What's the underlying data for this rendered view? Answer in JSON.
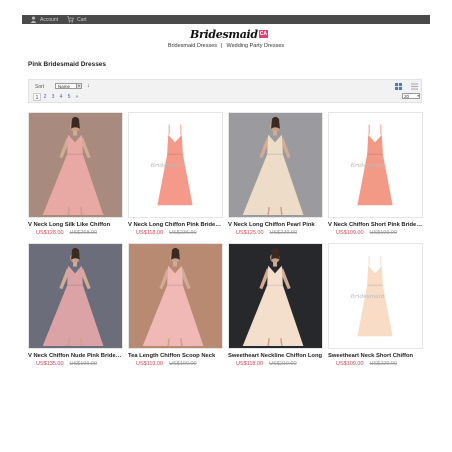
{
  "topbar": {
    "account": "Account",
    "cart": "Cart"
  },
  "logo": {
    "text": "Bridesmaid",
    "badge": "CA"
  },
  "subnav": {
    "item1": "Bridesmaid Dresses",
    "sep": "|",
    "item2": "Wedding Party Dresses"
  },
  "page_title": "Pink Bridesmaid Dresses",
  "toolbar": {
    "sort_label": "Sort",
    "sort_value": "Name",
    "sort_dir": "↓",
    "pages": [
      "1",
      "2",
      "3",
      "4",
      "5",
      "»"
    ],
    "current_page": "1",
    "limit": "20"
  },
  "products": [
    {
      "name": "V Neck Long Silk Like Chiffon",
      "price": "US$128.00",
      "old_price": "US$268.00",
      "dress_color": "#e8a8a4",
      "bg_color": "#a98a7f",
      "watermark": ""
    },
    {
      "name": "V Neck Long Chiffon Pink Bridesmaid",
      "price": "US$118.00",
      "old_price": "US$236.00",
      "dress_color": "#f59a8a",
      "bg_color": "#ffffff",
      "watermark": "Bridesmaid"
    },
    {
      "name": "V Neck Long Chiffon Pearl Pink",
      "price": "US$125.00",
      "old_price": "US$229.00",
      "dress_color": "#eddcc8",
      "bg_color": "#9b9b9f",
      "watermark": ""
    },
    {
      "name": "V Neck Chiffon Short Pink Bridesmaid",
      "price": "US$109.00",
      "old_price": "US$199.00",
      "dress_color": "#f39a86",
      "bg_color": "#ffffff",
      "watermark": "Bridesmaid"
    },
    {
      "name": "V Neck Chiffon Nude Pink Bridesmaid",
      "price": "US$135.00",
      "old_price": "US$199.00",
      "dress_color": "#dca3a6",
      "bg_color": "#6c6d7b",
      "watermark": ""
    },
    {
      "name": "Tea Length Chiffon Scoop Neck",
      "price": "US$119.00",
      "old_price": "US$190.00",
      "dress_color": "#f0b9b6",
      "bg_color": "#b98a72",
      "watermark": ""
    },
    {
      "name": "Sweetheart Neckline Chiffon Long",
      "price": "US$118.00",
      "old_price": "US$219.00",
      "dress_color": "#f4dfcd",
      "bg_color": "#26282c",
      "watermark": ""
    },
    {
      "name": "Sweetheart Neck Short Chiffon",
      "price": "US$109.00",
      "old_price": "US$229.00",
      "dress_color": "#f8dcc6",
      "bg_color": "#ffffff",
      "watermark": "Bridesmaid"
    }
  ]
}
